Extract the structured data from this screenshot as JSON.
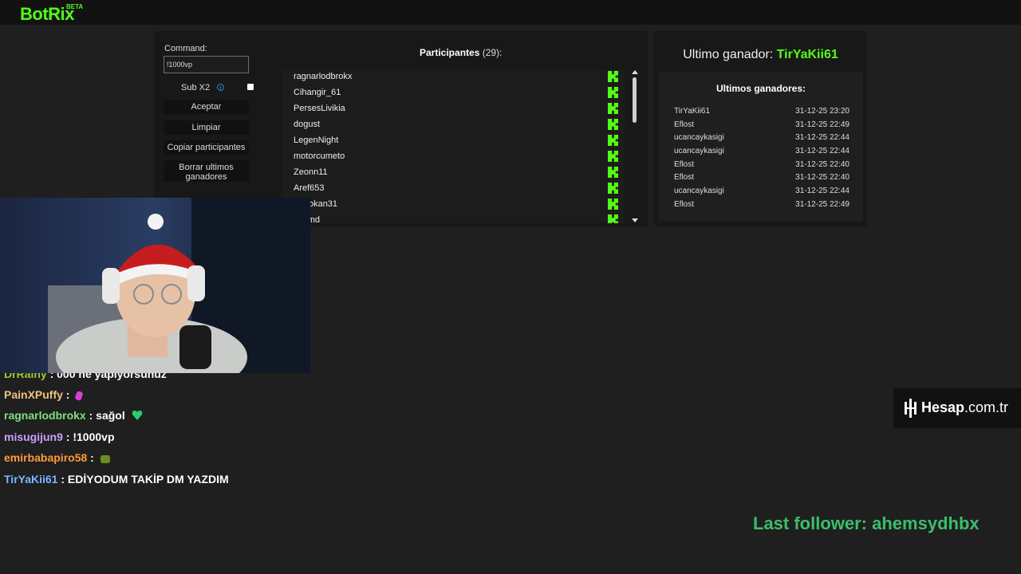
{
  "header": {
    "logo": "BotRix",
    "badge": "BETA"
  },
  "controls": {
    "command_label": "Command:",
    "command_value": "!1000vp",
    "subx2_label": "Sub X2",
    "buttons": {
      "accept": "Aceptar",
      "clear": "Limpiar",
      "copy": "Copiar participantes",
      "delete_winners": "Borrar ultimos\nganadores"
    }
  },
  "participants": {
    "title": "Participantes",
    "count": "(29):",
    "items": [
      "ragnarlodbrokx",
      "Cihangir_61",
      "PersesLivikia",
      "dogust",
      "LegenNight",
      "motorcumeto",
      "Zeonn11",
      "Aref653",
      "akSokan31",
      "ukdmd"
    ]
  },
  "winners": {
    "last_winner_label": "Ultimo ganador:",
    "last_winner_name": "TirYaKii61",
    "list_title": "Ultimos ganadores:",
    "rows": [
      {
        "name": "TirYaKii61",
        "date": "31-12-25 23:20"
      },
      {
        "name": "Eflost",
        "date": "31-12-25 22:49"
      },
      {
        "name": "ucancaykasigi",
        "date": "31-12-25 22:44"
      },
      {
        "name": "ucancaykasigi",
        "date": "31-12-25 22:44"
      },
      {
        "name": "Eflost",
        "date": "31-12-25 22:40"
      },
      {
        "name": "Eflost",
        "date": "31-12-25 22:40"
      },
      {
        "name": "ucancaykasigi",
        "date": "31-12-25 22:44"
      },
      {
        "name": "Eflost",
        "date": "31-12-25 22:49"
      }
    ]
  },
  "chat": [
    {
      "user": "DrRainy",
      "message": "000 ne yapıyorsunuz",
      "color": "#9acd32"
    },
    {
      "user": "PainXPuffy",
      "message": "",
      "color": "#f0c27b",
      "emote": "#d63fd6"
    },
    {
      "user": "ragnarlodbrokx",
      "message": "sağol",
      "color": "#7fe07f",
      "emote": "#2ecc71"
    },
    {
      "user": "misugijun9",
      "message": "!1000vp",
      "color": "#c9a0ff"
    },
    {
      "user": "emirbabapiro58",
      "message": "",
      "color": "#ff9a3c",
      "emote": "#6b8e23"
    },
    {
      "user": "TirYaKii61",
      "message": "EDİYODUM TAKİP DM YAZDIM",
      "color": "#7ab8ff"
    }
  ],
  "sponsor": {
    "name": "Hesap",
    "suffix": ".com.tr"
  },
  "last_follower": "Last follower: ahemsydhbx",
  "colors": {
    "accent": "#53fc18",
    "follower": "#3bbf6a"
  }
}
